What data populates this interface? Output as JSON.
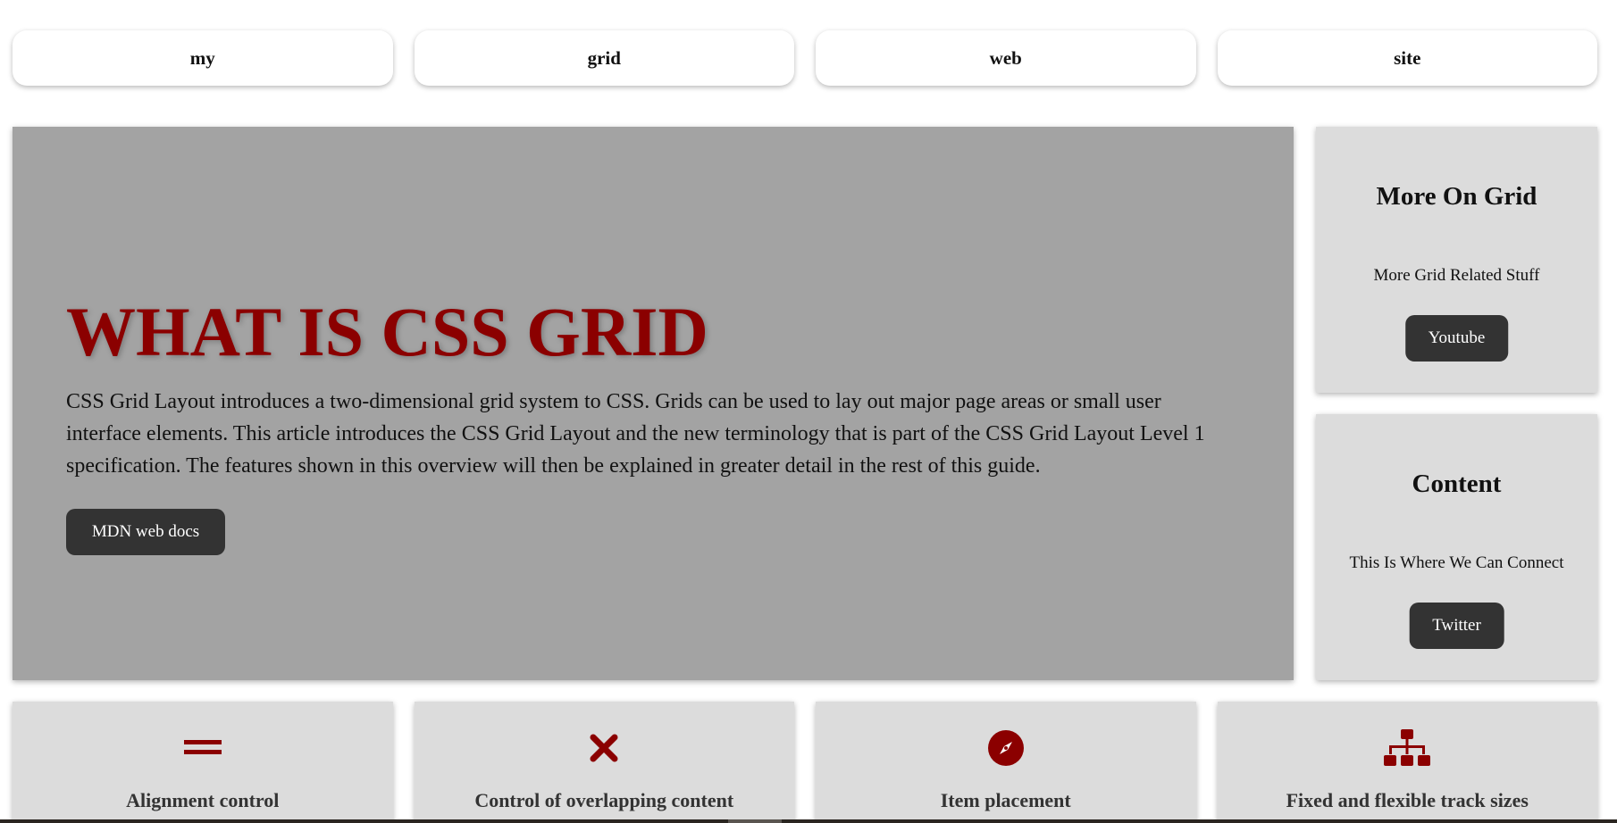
{
  "nav": {
    "items": [
      {
        "label": "my"
      },
      {
        "label": "grid"
      },
      {
        "label": "web"
      },
      {
        "label": "site"
      }
    ]
  },
  "hero": {
    "title": "WHAT IS CSS GRID",
    "text": "CSS Grid Layout introduces a two-dimensional grid system to CSS. Grids can be used to lay out major page areas or small user interface elements. This article introduces the CSS Grid Layout and the new terminology that is part of the CSS Grid Layout Level 1 specification. The features shown in this overview will then be explained in greater detail in the rest of this guide.",
    "button_label": "MDN web docs"
  },
  "side_cards": [
    {
      "title": "More On Grid",
      "text": "More Grid Related Stuff",
      "button_label": "Youtube"
    },
    {
      "title": "Content",
      "text": "This Is Where We Can Connect",
      "button_label": "Twitter"
    }
  ],
  "features": [
    {
      "icon": "equals-icon",
      "label": "Alignment control"
    },
    {
      "icon": "times-icon",
      "label": "Control of overlapping content"
    },
    {
      "icon": "compass-icon",
      "label": "Item placement"
    },
    {
      "icon": "sitemap-icon",
      "label": "Fixed and flexible track sizes"
    }
  ],
  "colors": {
    "accent": "#8b0000",
    "hero_bg": "#a3a3a3",
    "card_bg": "#dcdcdc",
    "button_bg": "#333333"
  }
}
